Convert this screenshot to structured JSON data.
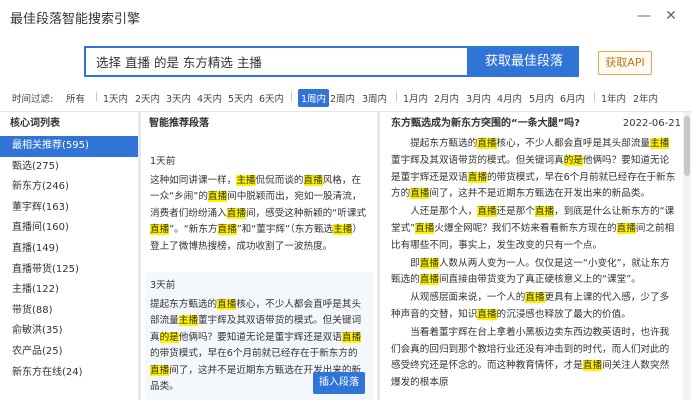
{
  "app": {
    "title": "最佳段落智能搜索引擎"
  },
  "search": {
    "value": "选择 直播 的是 东方精选 主播",
    "button": "获取最佳段落",
    "api_button": "获取API"
  },
  "filter": {
    "label": "时间过滤:",
    "options": [
      "所有",
      "1天内",
      "2天内",
      "3天内",
      "4天内",
      "5天内",
      "6天内",
      "1周内",
      "2周内",
      "3周内",
      "1月内",
      "2月内",
      "3月内",
      "4月内",
      "5月内",
      "6月内",
      "1年内",
      "2年内"
    ],
    "active": "1周内"
  },
  "keywords": {
    "header": "核心词列表",
    "items": [
      "最相关推荐(595)",
      "甄选(275)",
      "新东方(246)",
      "董宇辉(163)",
      "直播间(160)",
      "直播(149)",
      "直播带货(125)",
      "主播(122)",
      "带货(88)",
      "俞敏洪(35)",
      "农产品(25)",
      "新东方在线(24)"
    ]
  },
  "recommend": {
    "header": "智能推荐段落",
    "insert_label": "插入段落",
    "cards": [
      {
        "time": "1天前",
        "segments": [
          [
            "这种如同讲课一样，",
            false
          ],
          [
            "主播",
            true
          ],
          [
            "侃侃而谈的",
            false
          ],
          [
            "直播",
            true
          ],
          [
            "风格，在一众“乡闹”的",
            false
          ],
          [
            "直播",
            true
          ],
          [
            "间中脱颖而出，宛如一股清流，消费者们纷纷涌入",
            false
          ],
          [
            "直播",
            true
          ],
          [
            "间，感受这种新颖的“听课式",
            false
          ],
          [
            "直播",
            true
          ],
          [
            "”。“新东方",
            false
          ],
          [
            "直播",
            true
          ],
          [
            "”和“董宇辉”（东方甄选",
            false
          ],
          [
            "主播",
            true
          ],
          [
            "）登上了微博热搜榜，成功收割了一波热度。",
            false
          ]
        ]
      },
      {
        "time": "3天前",
        "segments": [
          [
            "提起东方甄选的",
            false
          ],
          [
            "直播",
            true
          ],
          [
            "核心，不少人都会直呼是其头部流量",
            false
          ],
          [
            "主播",
            true
          ],
          [
            "董宇辉及其双语带货的模式。但关键词真",
            false
          ],
          [
            "的是",
            true
          ],
          [
            "他俩吗？要知道无论是董宇辉还是双语",
            false
          ],
          [
            "直播",
            true
          ],
          [
            "的带货模式，早在6个月前就已经存在于新东方的",
            false
          ],
          [
            "直播",
            true
          ],
          [
            "间了，这并不是近期东方甄选在开发出来的新品类。",
            false
          ]
        ]
      }
    ]
  },
  "article": {
    "title": "东方甄选成为新东方突围的“一条大腿”吗?",
    "date": "2022-06-21",
    "paragraphs": [
      [
        [
          "提起东方甄选的",
          false
        ],
        [
          "直播",
          true
        ],
        [
          "核心，不少人都会直呼是其头部流量",
          false
        ],
        [
          "主播",
          true
        ],
        [
          "董宇辉及其双语带货的模式。但关键词真",
          false
        ],
        [
          "的是",
          true
        ],
        [
          "他俩吗？要知道无论是董宇辉还是双语",
          false
        ],
        [
          "直播",
          true
        ],
        [
          "的带货模式，早在6个月前就已经存在于新东方的",
          false
        ],
        [
          "直播",
          true
        ],
        [
          "间了，这并不是近期东方甄选在开发出来的新品类。",
          false
        ]
      ],
      [
        [
          "人还是那个人，",
          false
        ],
        [
          "直播",
          true
        ],
        [
          "还是那个",
          false
        ],
        [
          "直播",
          true
        ],
        [
          "，到底是什么让新东方的“课堂式”",
          false
        ],
        [
          "直播",
          true
        ],
        [
          "火爆全网呢？我们不妨来看看新东方现在的",
          false
        ],
        [
          "直播",
          true
        ],
        [
          "间之前相比有哪些不同，事实上，发生改变的只有一个点。",
          false
        ]
      ],
      [
        [
          "即",
          false
        ],
        [
          "直播",
          true
        ],
        [
          "人数从两人变为一人。仅仅是这一“小变化”，就让东方甄选的",
          false
        ],
        [
          "直播",
          true
        ],
        [
          "间直接由带货变为了真正硬核意义上的“课堂”。",
          false
        ]
      ],
      [
        [
          "从观感层面来说，一个人的",
          false
        ],
        [
          "直播",
          true
        ],
        [
          "更具有上课的代入感，少了多种声音的交替，知识",
          false
        ],
        [
          "直播",
          true
        ],
        [
          "的沉浸感也释放了最大的价值。",
          false
        ]
      ],
      [
        [
          "当看着董宇辉在台上拿着小黑板边卖东西边教英语时，也许我们会真的回归到那个教培行业还没有冲击到的时代，而人们对此的感受终究还是怀念的。而这种教育情怀，才是",
          false
        ],
        [
          "直播",
          true
        ],
        [
          "间关注人数突然爆发的根本原",
          false
        ]
      ]
    ]
  }
}
